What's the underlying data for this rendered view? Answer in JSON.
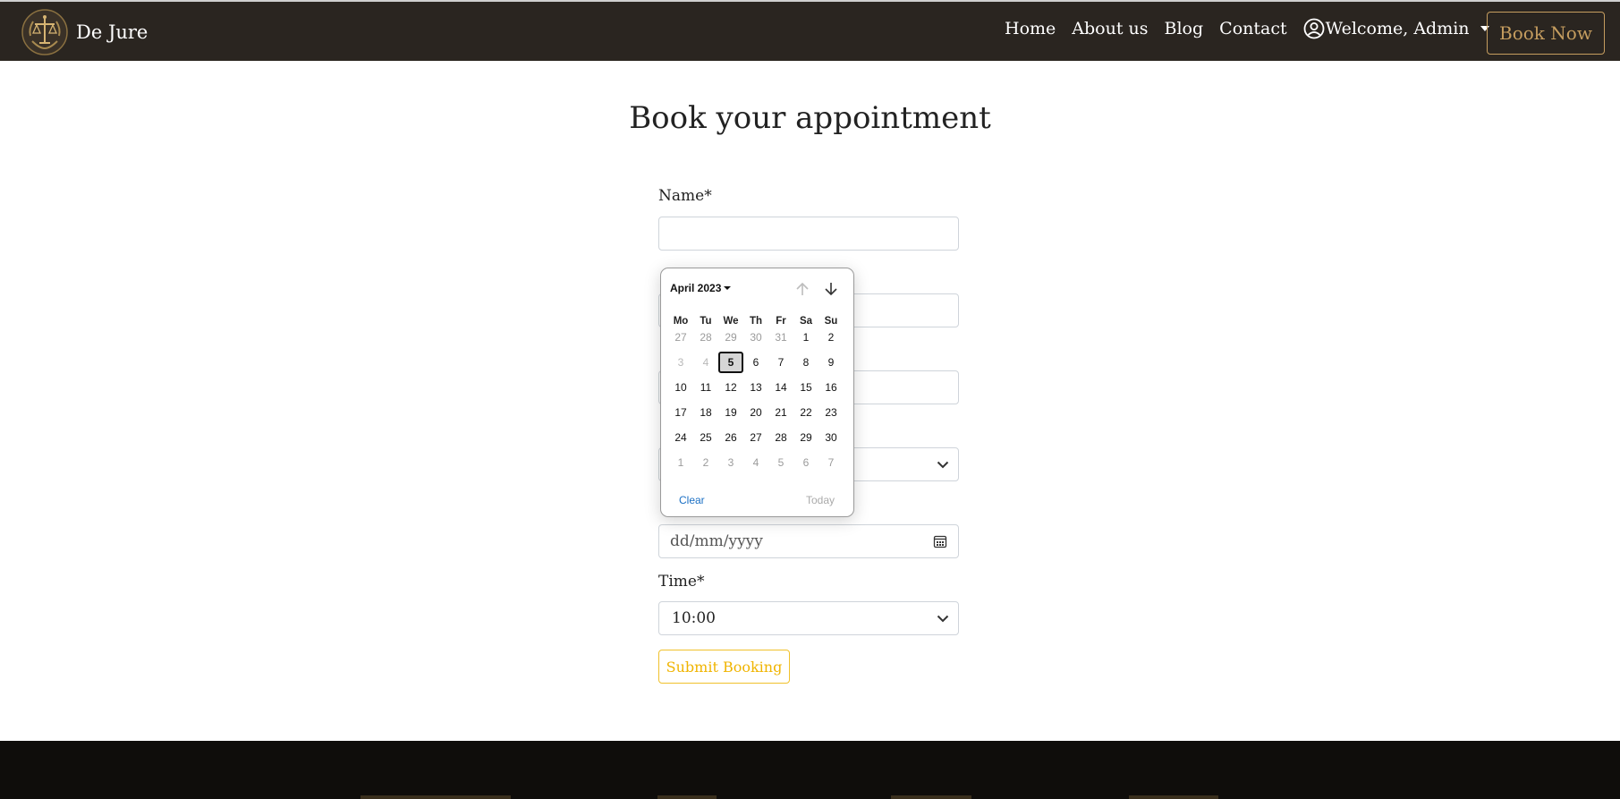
{
  "navbar": {
    "brand": "De Jure",
    "links": [
      "Home",
      "About us",
      "Blog",
      "Contact"
    ],
    "user": "Welcome, Admin",
    "book_now": "Book Now"
  },
  "main": {
    "title": "Book your appointment",
    "name_label": "Name*",
    "name_value": "",
    "date_placeholder": "dd/mm/yyyy",
    "time_label": "Time*",
    "time_value": "10:00",
    "submit_label": "Submit Booking"
  },
  "datepicker": {
    "month": "April 2023",
    "weekdays": [
      "Mo",
      "Tu",
      "We",
      "Th",
      "Fr",
      "Sa",
      "Su"
    ],
    "weeks": [
      [
        "27",
        "28",
        "29",
        "30",
        "31",
        "1",
        "2"
      ],
      [
        "3",
        "4",
        "5",
        "6",
        "7",
        "8",
        "9"
      ],
      [
        "10",
        "11",
        "12",
        "13",
        "14",
        "15",
        "16"
      ],
      [
        "17",
        "18",
        "19",
        "20",
        "21",
        "22",
        "23"
      ],
      [
        "24",
        "25",
        "26",
        "27",
        "28",
        "29",
        "30"
      ],
      [
        "1",
        "2",
        "3",
        "4",
        "5",
        "6",
        "7"
      ]
    ],
    "selected": "5",
    "clear": "Clear",
    "today": "Today"
  },
  "colors": {
    "navbar_bg": "#2a2520",
    "gold": "#c59d5f",
    "submit_accent": "#f0b400",
    "footer_bg": "#0f0d0b"
  },
  "icons": [
    "scales-of-justice-logo",
    "user-circle-icon",
    "chevron-down-icon",
    "calendar-icon",
    "arrow-up-icon",
    "arrow-down-icon"
  ]
}
